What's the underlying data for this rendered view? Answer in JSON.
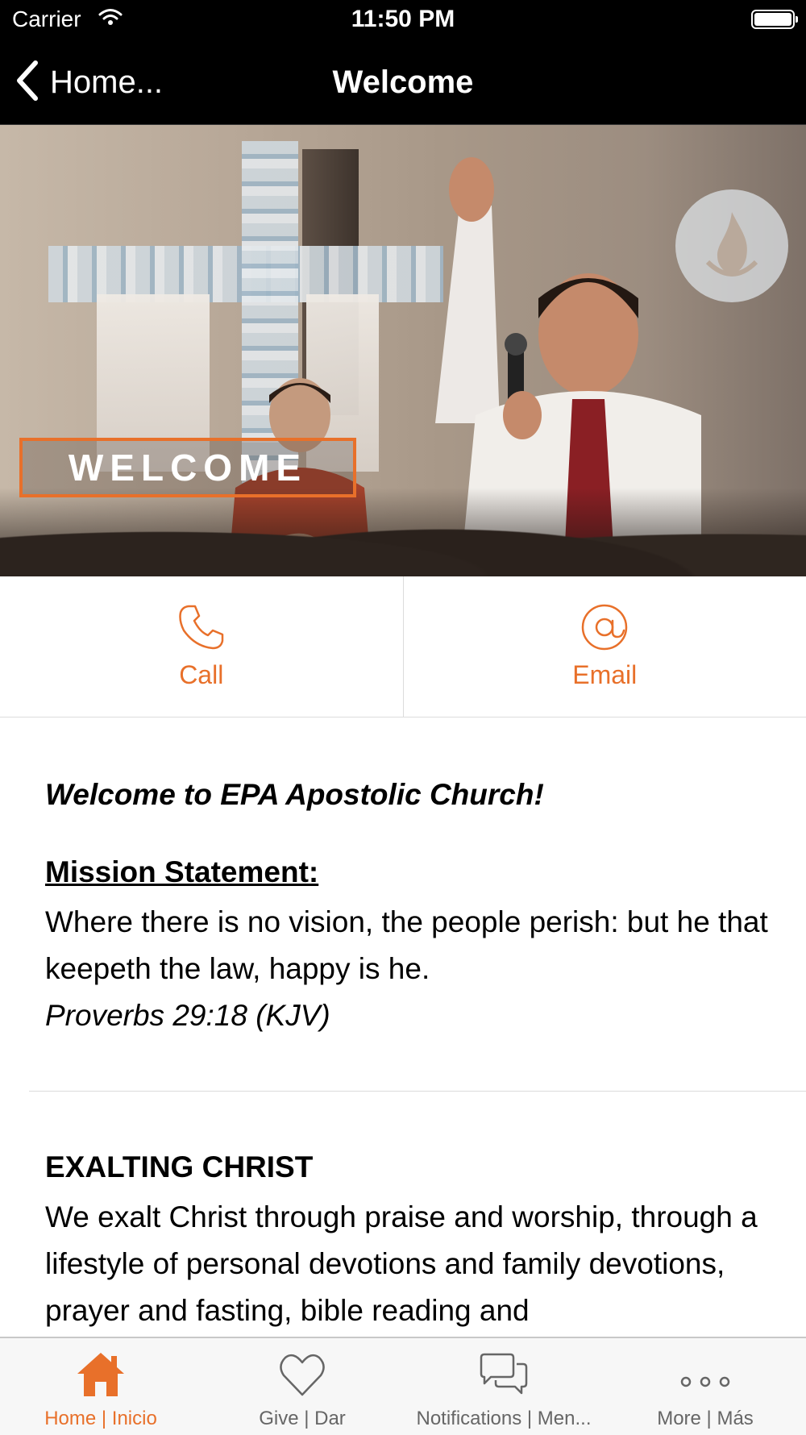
{
  "status_bar": {
    "carrier": "Carrier",
    "time": "11:50 PM"
  },
  "nav": {
    "back_label": "Home...",
    "title": "Welcome"
  },
  "hero": {
    "banner_text": "WELCOME"
  },
  "actions": [
    {
      "label": "Call",
      "icon": "phone-icon"
    },
    {
      "label": "Email",
      "icon": "at-sign-icon"
    }
  ],
  "content": {
    "intro": "Welcome to EPA Apostolic Church!",
    "mission_heading": "Mission Statement:",
    "mission_text": "Where there is no vision, the people perish: but he that keepeth the law, happy is he.",
    "mission_ref": "Proverbs 29:18 (KJV)",
    "section_heading": "EXALTING CHRIST",
    "section_text": "We exalt Christ through praise and worship, through a lifestyle of personal devotions and family devotions, prayer and fasting, bible reading and"
  },
  "tabs": [
    {
      "label": "Home | Inicio",
      "icon": "home-icon",
      "active": true
    },
    {
      "label": "Give | Dar",
      "icon": "heart-icon",
      "active": false
    },
    {
      "label": "Notifications | Men...",
      "icon": "chat-bubbles-icon",
      "active": false
    },
    {
      "label": "More | Más",
      "icon": "more-dots-icon",
      "active": false
    }
  ],
  "colors": {
    "accent": "#e8702a",
    "bar_background": "#000000",
    "tab_bar_background": "#f7f7f7",
    "inactive_tab": "#666666"
  }
}
